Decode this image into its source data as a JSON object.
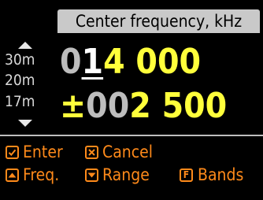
{
  "title": "Center frequency, kHz",
  "bands": [
    "30m",
    "20m",
    "17m"
  ],
  "center_frequency": {
    "dim_prefix": "0",
    "cursor_digit": "1",
    "value": "4 000"
  },
  "range": {
    "sign": "±",
    "dim_prefix": "00",
    "value": "2 500"
  },
  "keys": {
    "enter": "Enter",
    "cancel": "Cancel",
    "freq": "Freq.",
    "range": "Range",
    "bands": "Bands",
    "bands_key_letter": "F"
  },
  "colors": {
    "accent": "#ff8a1a",
    "value": "#ffff3b",
    "dim": "#bdbdbd",
    "title_bg": "#c9c9c9"
  }
}
